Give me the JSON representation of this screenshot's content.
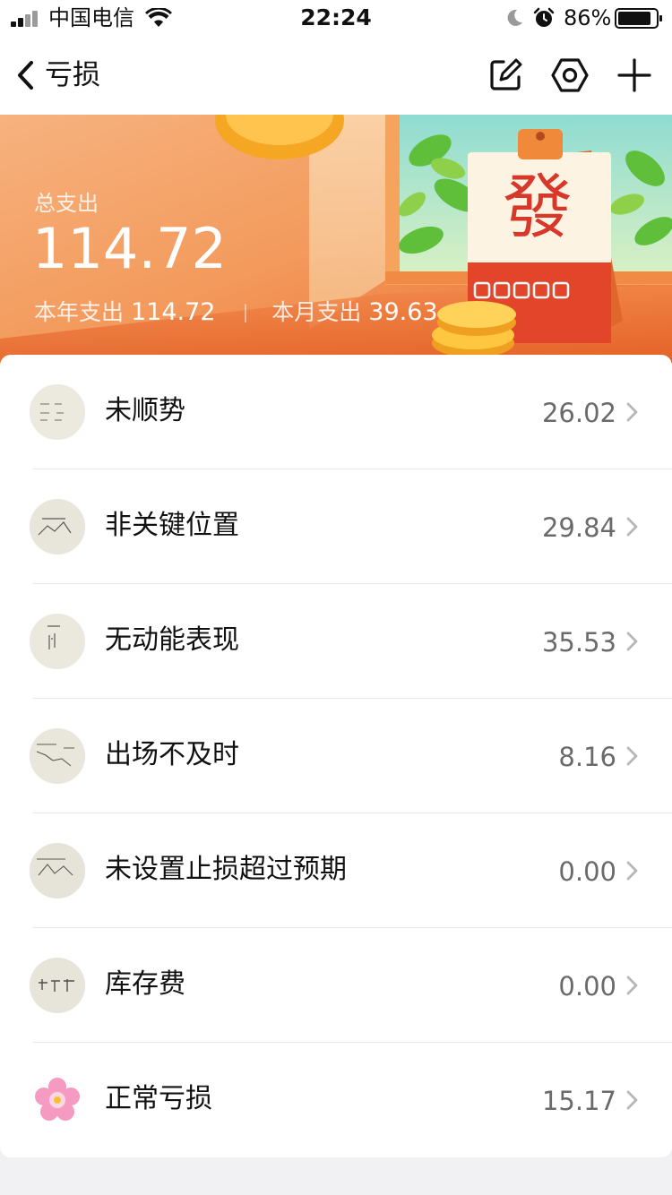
{
  "status_bar": {
    "carrier": "中国电信",
    "time": "22:24",
    "battery": "86%"
  },
  "nav": {
    "title": "亏损",
    "icons": [
      "back-chevron-icon",
      "edit-icon",
      "settings-hex-icon",
      "plus-icon"
    ]
  },
  "summary": {
    "total_label": "总支出",
    "total_value": "114.72",
    "year_label": "本年支出",
    "year_value": "114.72",
    "month_label": "本月支出",
    "month_value": "39.63",
    "calendar_char": "發"
  },
  "categories": [
    {
      "label": "未顺势",
      "amount": "26.02"
    },
    {
      "label": "非关键位置",
      "amount": "29.84"
    },
    {
      "label": "无动能表现",
      "amount": "35.53"
    },
    {
      "label": "出场不及时",
      "amount": "8.16"
    },
    {
      "label": "未设置止损超过预期",
      "amount": "0.00"
    },
    {
      "label": "库存费",
      "amount": "0.00"
    },
    {
      "label": "正常亏损",
      "amount": "15.17"
    }
  ],
  "colors": {
    "banner_orange": "#f07a3c",
    "amount_gray": "#6a6a6a",
    "calendar_red": "#e2452a"
  }
}
